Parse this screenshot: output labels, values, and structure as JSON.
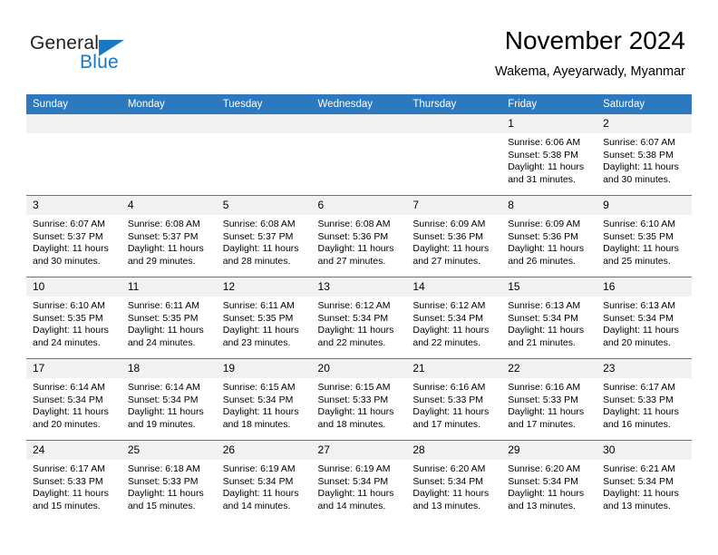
{
  "brand": {
    "name_part1": "General",
    "name_part2": "Blue",
    "accent_color": "#1878c4"
  },
  "header": {
    "title": "November 2024",
    "subtitle": "Wakema, Ayeyarwady, Myanmar"
  },
  "theme": {
    "header_bar_color": "#2c79bf",
    "row_divider_color": "#3c7fc0",
    "daynum_band_color": "#f1f1f1",
    "page_background": "#ffffff"
  },
  "weekdays": [
    "Sunday",
    "Monday",
    "Tuesday",
    "Wednesday",
    "Thursday",
    "Friday",
    "Saturday"
  ],
  "labels": {
    "sunrise_prefix": "Sunrise:",
    "sunset_prefix": "Sunset:",
    "daylight_prefix": "Daylight:"
  },
  "weeks": [
    [
      {
        "day": "",
        "empty": true
      },
      {
        "day": "",
        "empty": true
      },
      {
        "day": "",
        "empty": true
      },
      {
        "day": "",
        "empty": true
      },
      {
        "day": "",
        "empty": true
      },
      {
        "day": "1",
        "sunrise": "Sunrise: 6:06 AM",
        "sunset": "Sunset: 5:38 PM",
        "daylight": "Daylight: 11 hours and 31 minutes."
      },
      {
        "day": "2",
        "sunrise": "Sunrise: 6:07 AM",
        "sunset": "Sunset: 5:38 PM",
        "daylight": "Daylight: 11 hours and 30 minutes."
      }
    ],
    [
      {
        "day": "3",
        "sunrise": "Sunrise: 6:07 AM",
        "sunset": "Sunset: 5:37 PM",
        "daylight": "Daylight: 11 hours and 30 minutes."
      },
      {
        "day": "4",
        "sunrise": "Sunrise: 6:08 AM",
        "sunset": "Sunset: 5:37 PM",
        "daylight": "Daylight: 11 hours and 29 minutes."
      },
      {
        "day": "5",
        "sunrise": "Sunrise: 6:08 AM",
        "sunset": "Sunset: 5:37 PM",
        "daylight": "Daylight: 11 hours and 28 minutes."
      },
      {
        "day": "6",
        "sunrise": "Sunrise: 6:08 AM",
        "sunset": "Sunset: 5:36 PM",
        "daylight": "Daylight: 11 hours and 27 minutes."
      },
      {
        "day": "7",
        "sunrise": "Sunrise: 6:09 AM",
        "sunset": "Sunset: 5:36 PM",
        "daylight": "Daylight: 11 hours and 27 minutes."
      },
      {
        "day": "8",
        "sunrise": "Sunrise: 6:09 AM",
        "sunset": "Sunset: 5:36 PM",
        "daylight": "Daylight: 11 hours and 26 minutes."
      },
      {
        "day": "9",
        "sunrise": "Sunrise: 6:10 AM",
        "sunset": "Sunset: 5:35 PM",
        "daylight": "Daylight: 11 hours and 25 minutes."
      }
    ],
    [
      {
        "day": "10",
        "sunrise": "Sunrise: 6:10 AM",
        "sunset": "Sunset: 5:35 PM",
        "daylight": "Daylight: 11 hours and 24 minutes."
      },
      {
        "day": "11",
        "sunrise": "Sunrise: 6:11 AM",
        "sunset": "Sunset: 5:35 PM",
        "daylight": "Daylight: 11 hours and 24 minutes."
      },
      {
        "day": "12",
        "sunrise": "Sunrise: 6:11 AM",
        "sunset": "Sunset: 5:35 PM",
        "daylight": "Daylight: 11 hours and 23 minutes."
      },
      {
        "day": "13",
        "sunrise": "Sunrise: 6:12 AM",
        "sunset": "Sunset: 5:34 PM",
        "daylight": "Daylight: 11 hours and 22 minutes."
      },
      {
        "day": "14",
        "sunrise": "Sunrise: 6:12 AM",
        "sunset": "Sunset: 5:34 PM",
        "daylight": "Daylight: 11 hours and 22 minutes."
      },
      {
        "day": "15",
        "sunrise": "Sunrise: 6:13 AM",
        "sunset": "Sunset: 5:34 PM",
        "daylight": "Daylight: 11 hours and 21 minutes."
      },
      {
        "day": "16",
        "sunrise": "Sunrise: 6:13 AM",
        "sunset": "Sunset: 5:34 PM",
        "daylight": "Daylight: 11 hours and 20 minutes."
      }
    ],
    [
      {
        "day": "17",
        "sunrise": "Sunrise: 6:14 AM",
        "sunset": "Sunset: 5:34 PM",
        "daylight": "Daylight: 11 hours and 20 minutes."
      },
      {
        "day": "18",
        "sunrise": "Sunrise: 6:14 AM",
        "sunset": "Sunset: 5:34 PM",
        "daylight": "Daylight: 11 hours and 19 minutes."
      },
      {
        "day": "19",
        "sunrise": "Sunrise: 6:15 AM",
        "sunset": "Sunset: 5:34 PM",
        "daylight": "Daylight: 11 hours and 18 minutes."
      },
      {
        "day": "20",
        "sunrise": "Sunrise: 6:15 AM",
        "sunset": "Sunset: 5:33 PM",
        "daylight": "Daylight: 11 hours and 18 minutes."
      },
      {
        "day": "21",
        "sunrise": "Sunrise: 6:16 AM",
        "sunset": "Sunset: 5:33 PM",
        "daylight": "Daylight: 11 hours and 17 minutes."
      },
      {
        "day": "22",
        "sunrise": "Sunrise: 6:16 AM",
        "sunset": "Sunset: 5:33 PM",
        "daylight": "Daylight: 11 hours and 17 minutes."
      },
      {
        "day": "23",
        "sunrise": "Sunrise: 6:17 AM",
        "sunset": "Sunset: 5:33 PM",
        "daylight": "Daylight: 11 hours and 16 minutes."
      }
    ],
    [
      {
        "day": "24",
        "sunrise": "Sunrise: 6:17 AM",
        "sunset": "Sunset: 5:33 PM",
        "daylight": "Daylight: 11 hours and 15 minutes."
      },
      {
        "day": "25",
        "sunrise": "Sunrise: 6:18 AM",
        "sunset": "Sunset: 5:33 PM",
        "daylight": "Daylight: 11 hours and 15 minutes."
      },
      {
        "day": "26",
        "sunrise": "Sunrise: 6:19 AM",
        "sunset": "Sunset: 5:34 PM",
        "daylight": "Daylight: 11 hours and 14 minutes."
      },
      {
        "day": "27",
        "sunrise": "Sunrise: 6:19 AM",
        "sunset": "Sunset: 5:34 PM",
        "daylight": "Daylight: 11 hours and 14 minutes."
      },
      {
        "day": "28",
        "sunrise": "Sunrise: 6:20 AM",
        "sunset": "Sunset: 5:34 PM",
        "daylight": "Daylight: 11 hours and 13 minutes."
      },
      {
        "day": "29",
        "sunrise": "Sunrise: 6:20 AM",
        "sunset": "Sunset: 5:34 PM",
        "daylight": "Daylight: 11 hours and 13 minutes."
      },
      {
        "day": "30",
        "sunrise": "Sunrise: 6:21 AM",
        "sunset": "Sunset: 5:34 PM",
        "daylight": "Daylight: 11 hours and 13 minutes."
      }
    ]
  ]
}
